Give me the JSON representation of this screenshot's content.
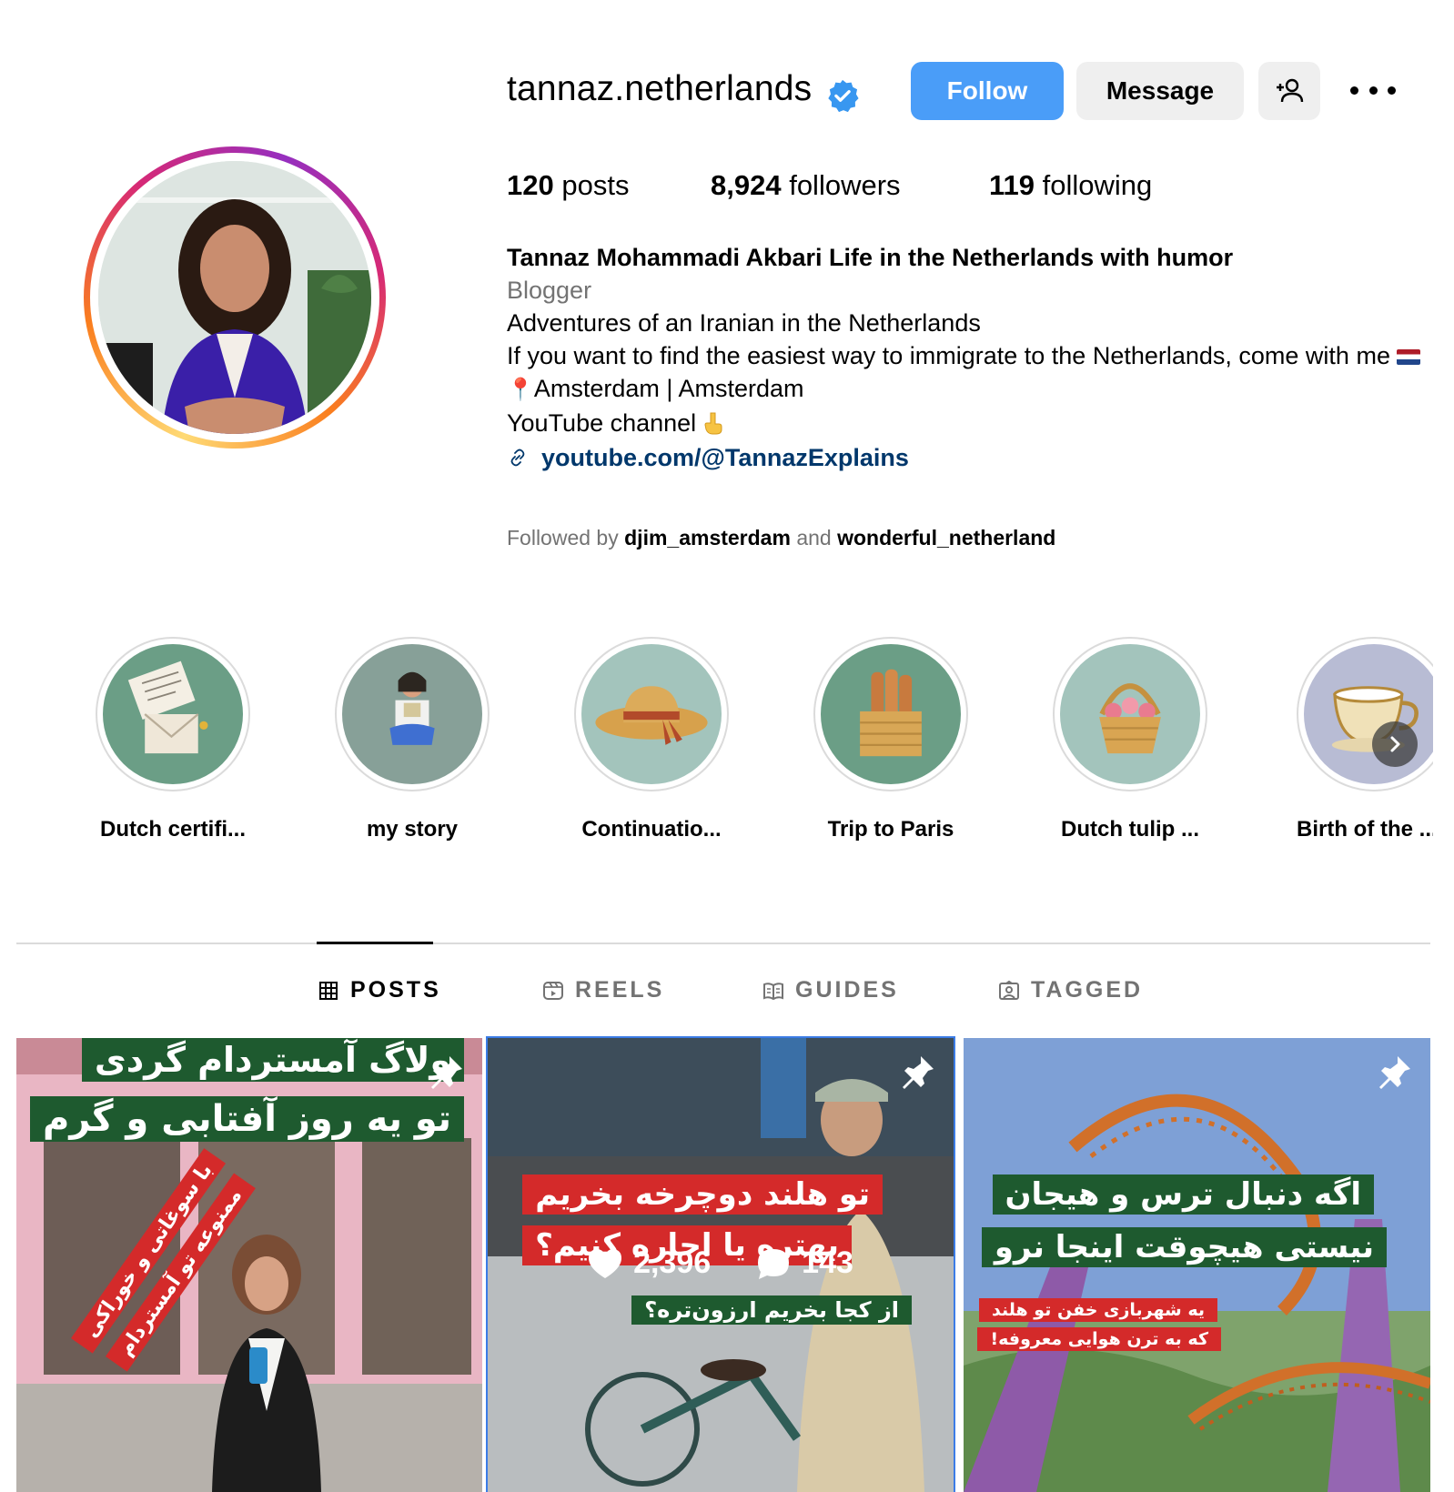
{
  "profile": {
    "username": "tannaz.netherlands",
    "follow_label": "Follow",
    "message_label": "Message",
    "posts_count": "120",
    "posts_label": "posts",
    "followers_count": "8,924",
    "followers_label": "followers",
    "following_count": "119",
    "following_label": "following",
    "display_name": "Tannaz Mohammadi Akbari Life in the Netherlands with humor",
    "category": "Blogger",
    "bio_line1": "Adventures of an Iranian in the Netherlands",
    "bio_line2": "If you want to find the easiest way to immigrate to the Netherlands, come with me",
    "location": "Amsterdam | Amsterdam",
    "youtube_line": "YouTube channel",
    "link": "youtube.com/@TannazExplains",
    "followed_by_prefix": "Followed by",
    "followed_by_user1": "djim_amsterdam",
    "followed_by_and": "and",
    "followed_by_user2": "wonderful_netherland"
  },
  "highlights": [
    {
      "label": "Dutch certifi...",
      "icon": "letters-icon",
      "bg": "#6b9e86"
    },
    {
      "label": "my story",
      "icon": "reading-woman-icon",
      "bg": "#87a098"
    },
    {
      "label": "Continuatio...",
      "icon": "sun-hat-icon",
      "bg": "#a3c4bc"
    },
    {
      "label": "Trip to Paris",
      "icon": "bread-basket-icon",
      "bg": "#6b9e86"
    },
    {
      "label": "Dutch tulip ...",
      "icon": "flower-basket-icon",
      "bg": "#a3c4bc"
    },
    {
      "label": "Birth of the ...",
      "icon": "teacup-icon",
      "bg": "#b8bcd4"
    }
  ],
  "tabs": [
    {
      "label": "POSTS",
      "icon": "grid-icon",
      "active": true
    },
    {
      "label": "REELS",
      "icon": "reels-icon",
      "active": false
    },
    {
      "label": "GUIDES",
      "icon": "guides-icon",
      "active": false
    },
    {
      "label": "TAGGED",
      "icon": "tagged-icon",
      "active": false
    }
  ],
  "posts": [
    {
      "pinned": true,
      "title_line1": "ولاگ آمستردام گردی",
      "title_line2": "تو یه روز آفتابی و گرم",
      "tag_line1": "با سوغاتی و خوراکی",
      "tag_line2": "ممنوعه تو آمستردام"
    },
    {
      "pinned": true,
      "title_line1": "تو هلند دوچرخه بخریم",
      "title_line2": "بهتره یا اجاره کنیم؟",
      "sub_line": "از کجا بخریم ارزون‌تره؟",
      "likes": "2,396",
      "comments": "143"
    },
    {
      "pinned": true,
      "title_line1": "اگه دنبال ترس و هیجان",
      "title_line2": "نیستی هیچوقت اینجا نرو",
      "sub_line1": "یه شهربازی خفن تو هلند",
      "sub_line2": "که به ترن هوایی معروفه!"
    }
  ],
  "colors": {
    "follow_button": "#4a9df8",
    "verified_badge": "#3897f0",
    "link": "#00376b",
    "selected_post_outline": "#3b7ce6"
  }
}
